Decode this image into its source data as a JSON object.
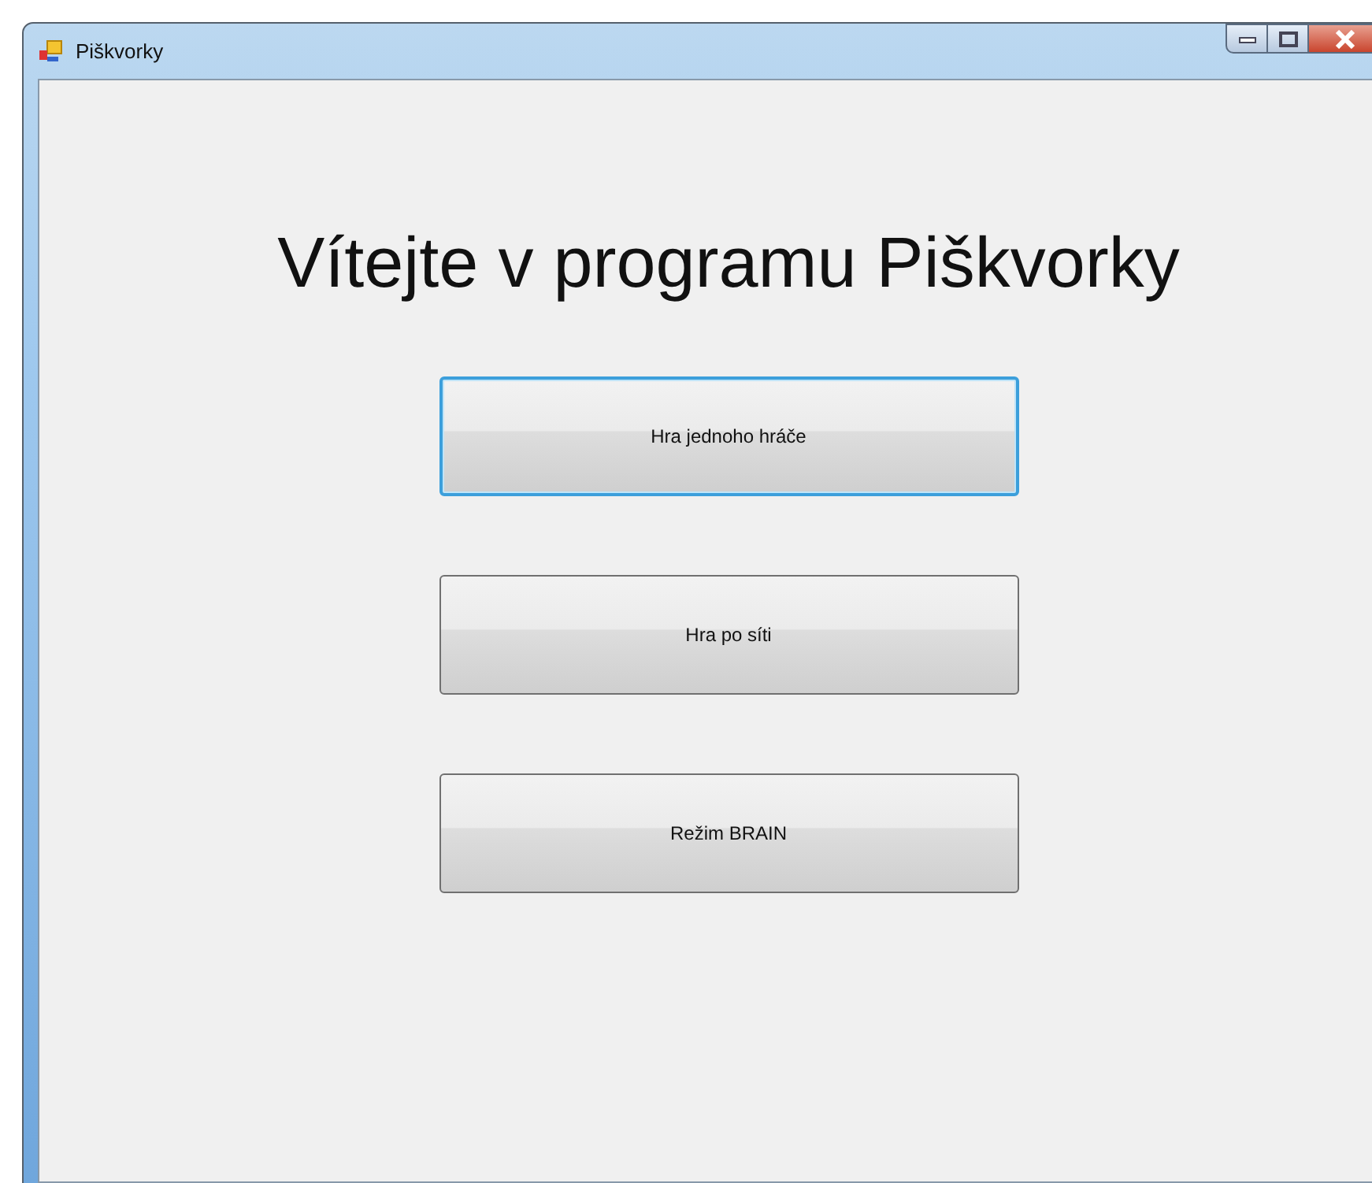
{
  "window": {
    "title": "Piškvorky"
  },
  "heading": "Vítejte v programu Piškvorky",
  "buttons": [
    {
      "label": "Hra jednoho hráče",
      "focused": true
    },
    {
      "label": "Hra po síti",
      "focused": false
    },
    {
      "label": "Režim BRAIN",
      "focused": false
    }
  ]
}
